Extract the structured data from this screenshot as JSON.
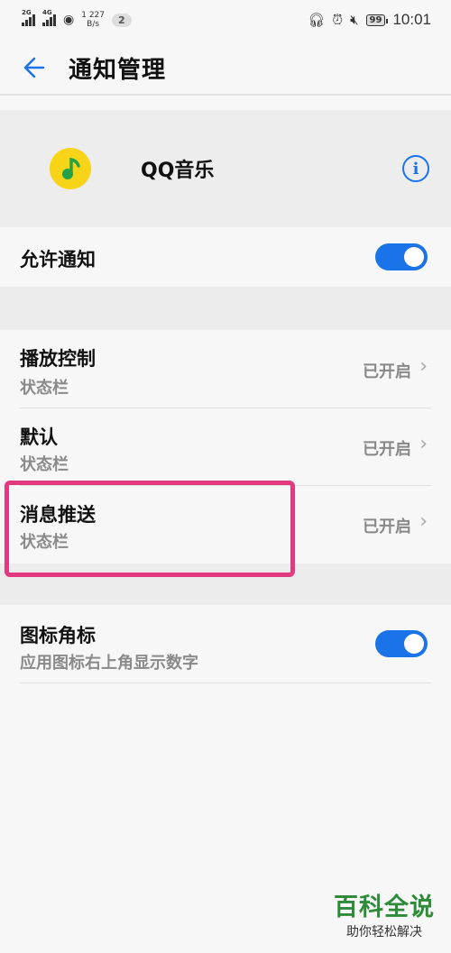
{
  "status_bar": {
    "sig1_label": "2G",
    "sig2_label": "4G",
    "speed_top": "1",
    "speed_value": "227",
    "speed_unit": "B/s",
    "notification_count": "2",
    "battery": "99",
    "time": "10:01",
    "icons": [
      "headphones-icon",
      "alarm-icon",
      "mute-icon"
    ]
  },
  "header": {
    "title": "通知管理",
    "back_icon": "arrow-left-icon"
  },
  "app": {
    "name": "QQ音乐",
    "info_icon": "info-icon"
  },
  "allow_notifications": {
    "label": "允许通知",
    "enabled": true
  },
  "channels": [
    {
      "title": "播放控制",
      "subtitle": "状态栏",
      "value": "已开启"
    },
    {
      "title": "默认",
      "subtitle": "状态栏",
      "value": "已开启"
    },
    {
      "title": "消息推送",
      "subtitle": "状态栏",
      "value": "已开启"
    }
  ],
  "badge": {
    "title": "图标角标",
    "subtitle": "应用图标右上角显示数字",
    "enabled": true
  },
  "watermark": {
    "main": "百科全说",
    "sub": "助你轻松解决"
  },
  "colors": {
    "accent": "#1a73e8",
    "highlight": "#e23a7f",
    "watermark": "#2e8b3a"
  }
}
